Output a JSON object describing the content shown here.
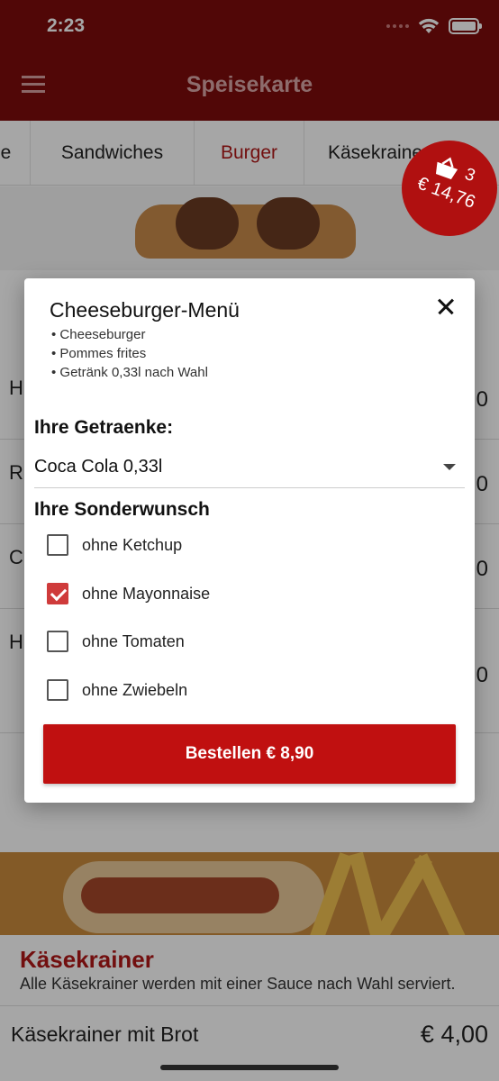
{
  "status_bar": {
    "time": "2:23"
  },
  "header": {
    "title": "Speisekarte"
  },
  "tabs": [
    {
      "label": "e"
    },
    {
      "label": "Sandwiches"
    },
    {
      "label": "Burger"
    },
    {
      "label": "Käsekrainer"
    }
  ],
  "cart": {
    "count": "3",
    "total": "€ 14,76"
  },
  "background_rows": [
    {
      "letter": "H",
      "price": "0"
    },
    {
      "letter": "R",
      "price": "0"
    },
    {
      "letter": "C",
      "price": "0"
    },
    {
      "letter": "H",
      "price": "0"
    }
  ],
  "section": {
    "title": "Käsekrainer",
    "description": "Alle Käsekrainer werden mit einer Sauce nach Wahl serviert.",
    "item_name": "Käsekrainer mit Brot",
    "item_price": "€ 4,00"
  },
  "dialog": {
    "title": "Cheeseburger-Menü",
    "description": [
      "Cheeseburger",
      "Pommes frites",
      "Getränk 0,33l nach Wahl"
    ],
    "drinks_label": "Ihre Getraenke:",
    "drink_selected": "Coca Cola 0,33l",
    "wish_label": "Ihre Sonderwunsch",
    "options": [
      {
        "label": "ohne Ketchup",
        "checked": false
      },
      {
        "label": "ohne Mayonnaise",
        "checked": true
      },
      {
        "label": "ohne Tomaten",
        "checked": false
      },
      {
        "label": "ohne Zwiebeln",
        "checked": false
      }
    ],
    "order_button": "Bestellen € 8,90"
  },
  "colors": {
    "header": "#7d0b0b",
    "accent": "#c01010",
    "checkbox_checked": "#cf3b3b"
  },
  "icons": [
    "wifi-icon",
    "battery-icon",
    "menu-icon",
    "basket-icon",
    "close-icon",
    "dropdown-arrow-icon",
    "checkbox-icon"
  ]
}
